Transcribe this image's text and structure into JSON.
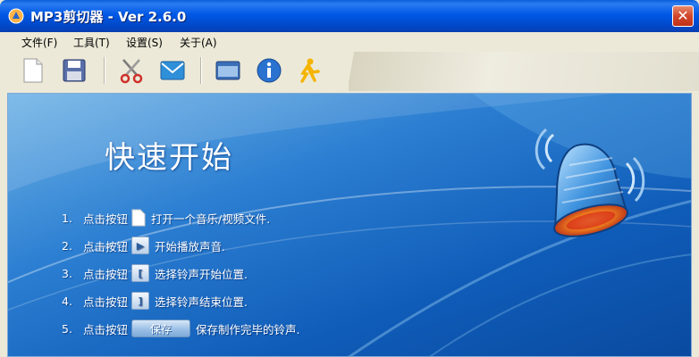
{
  "window": {
    "title": "MP3剪切器 - Ver 2.6.0",
    "close_glyph": "✕"
  },
  "menu": [
    {
      "label": "文件(F)"
    },
    {
      "label": "工具(T)"
    },
    {
      "label": "设置(S)"
    },
    {
      "label": "关于(A)"
    }
  ],
  "toolbar": {
    "buttons": [
      {
        "icon": "new-file-icon"
      },
      {
        "icon": "save-disk-icon"
      },
      {
        "icon": "scissors-icon"
      },
      {
        "icon": "mail-icon"
      },
      {
        "icon": "window-icon"
      },
      {
        "icon": "info-icon"
      },
      {
        "icon": "aim-runner-icon"
      }
    ]
  },
  "main": {
    "heading": "快速开始",
    "steps": [
      {
        "num": "1.",
        "pre": "点击按钮",
        "icon": "document-icon",
        "post": "打开一个音乐/视频文件."
      },
      {
        "num": "2.",
        "pre": "点击按钮",
        "icon": "play-icon",
        "glyph": "▶",
        "post": "开始播放声音."
      },
      {
        "num": "3.",
        "pre": "点击按钮",
        "icon": "start-mark-icon",
        "glyph": "[",
        "post": "选择铃声开始位置."
      },
      {
        "num": "4.",
        "pre": "点击按钮",
        "icon": "end-mark-icon",
        "glyph": "]",
        "post": "选择铃声结束位置."
      },
      {
        "num": "5.",
        "pre": "点击按钮",
        "button_label": "保存",
        "post": "保存制作完毕的铃声."
      }
    ]
  },
  "colors": {
    "title_bar": "#0058e6",
    "main_bg": "#2c7fd2",
    "accent_orange": "#f58a1f"
  }
}
